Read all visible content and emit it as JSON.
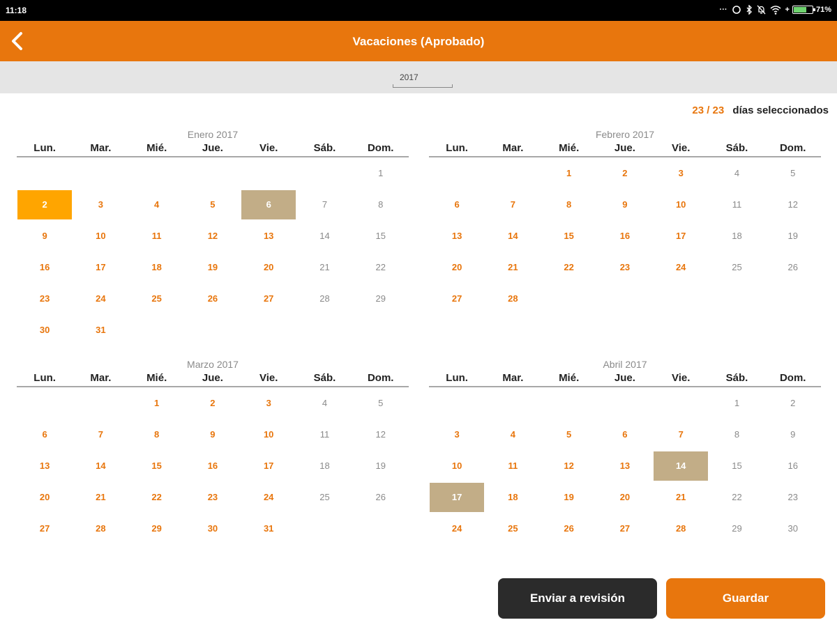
{
  "status_bar": {
    "time": "11:18",
    "battery": "71%",
    "battery_level": 0.71
  },
  "app_bar": {
    "title": "Vacaciones (Aprobado)"
  },
  "year_selector": {
    "value": "2017"
  },
  "selection": {
    "count": "23 / 23",
    "label": "días seleccionados"
  },
  "weekday_labels": [
    "Lun.",
    "Mar.",
    "Mié.",
    "Jue.",
    "Vie.",
    "Sáb.",
    "Dom."
  ],
  "months": [
    {
      "title": "Enero 2017",
      "offset": 6,
      "days": 31,
      "highlights": {
        "2": "orange",
        "6": "tan"
      }
    },
    {
      "title": "Febrero 2017",
      "offset": 2,
      "days": 28,
      "highlights": {}
    },
    {
      "title": "Marzo 2017",
      "offset": 2,
      "days": 31,
      "highlights": {}
    },
    {
      "title": "Abril 2017",
      "offset": 5,
      "days": 30,
      "highlights": {
        "14": "tan",
        "17": "tan"
      }
    }
  ],
  "buttons": {
    "review": "Enviar a revisión",
    "save": "Guardar"
  },
  "colors": {
    "accent": "#e8760d",
    "selected": "#ffa500",
    "holiday": "#c2ad87",
    "weekend_text": "#8a8a8a"
  }
}
